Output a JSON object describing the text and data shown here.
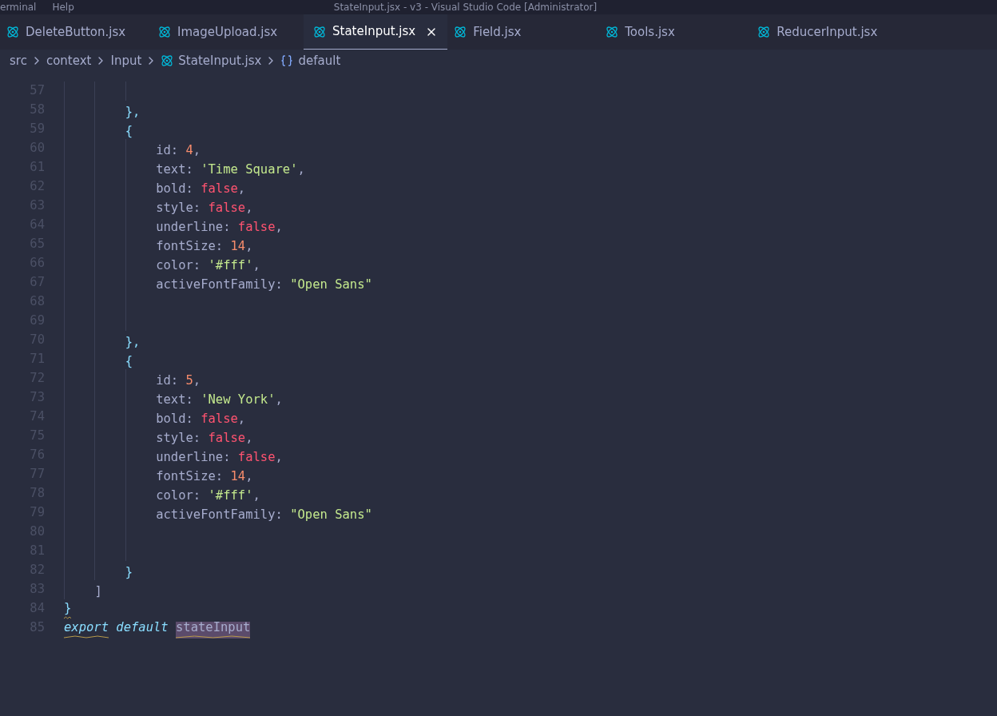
{
  "title_bar": {
    "menu": [
      "erminal",
      "Help"
    ],
    "title": "StateInput.jsx - v3 - Visual Studio Code [Administrator]"
  },
  "tabs": [
    {
      "label": "DeleteButton.jsx",
      "selected": false
    },
    {
      "label": "ImageUpload.jsx",
      "selected": false
    },
    {
      "label": "StateInput.jsx",
      "selected": true
    },
    {
      "label": "Field.jsx",
      "selected": false
    },
    {
      "label": "Tools.jsx",
      "selected": false
    },
    {
      "label": "ReducerInput.jsx",
      "selected": false
    }
  ],
  "breadcrumb": [
    {
      "label": "src",
      "kind": "folder"
    },
    {
      "label": "context",
      "kind": "folder"
    },
    {
      "label": "Input",
      "kind": "folder"
    },
    {
      "label": "StateInput.jsx",
      "kind": "file"
    },
    {
      "label": "default",
      "kind": "symbol"
    }
  ],
  "code": [
    {
      "number": "57",
      "kind": "property"
    },
    {
      "number": "58",
      "kind": "object",
      "tokens": [
        {
          "text": "},",
          "kind": "punct"
        }
      ]
    },
    {
      "number": "59",
      "kind": "object",
      "tokens": [
        {
          "text": "{",
          "kind": "punct"
        }
      ]
    },
    {
      "number": "60",
      "kind": "property",
      "tokens": [
        {
          "text": "id: ",
          "kind": "key"
        },
        {
          "text": "4",
          "kind": "number"
        },
        {
          "text": ",",
          "kind": "key"
        }
      ]
    },
    {
      "number": "61",
      "kind": "property",
      "tokens": [
        {
          "text": "text: ",
          "kind": "key"
        },
        {
          "text": "'Time Square'",
          "kind": "string"
        },
        {
          "text": ",",
          "kind": "key"
        }
      ]
    },
    {
      "number": "62",
      "kind": "property",
      "tokens": [
        {
          "text": "bold: ",
          "kind": "key"
        },
        {
          "text": "false",
          "kind": "boolean"
        },
        {
          "text": ",",
          "kind": "key"
        }
      ]
    },
    {
      "number": "63",
      "kind": "property",
      "tokens": [
        {
          "text": "style: ",
          "kind": "key"
        },
        {
          "text": "false",
          "kind": "boolean"
        },
        {
          "text": ",",
          "kind": "key"
        }
      ]
    },
    {
      "number": "64",
      "kind": "property",
      "tokens": [
        {
          "text": "underline: ",
          "kind": "key"
        },
        {
          "text": "false",
          "kind": "boolean"
        },
        {
          "text": ",",
          "kind": "key"
        }
      ]
    },
    {
      "number": "65",
      "kind": "property",
      "tokens": [
        {
          "text": "fontSize: ",
          "kind": "key"
        },
        {
          "text": "14",
          "kind": "number"
        },
        {
          "text": ",",
          "kind": "key"
        }
      ]
    },
    {
      "number": "66",
      "kind": "property",
      "tokens": [
        {
          "text": "color: ",
          "kind": "key"
        },
        {
          "text": "'#fff'",
          "kind": "string"
        },
        {
          "text": ",",
          "kind": "key"
        }
      ]
    },
    {
      "number": "67",
      "kind": "property",
      "tokens": [
        {
          "text": "activeFontFamily: ",
          "kind": "key"
        },
        {
          "text": "\"Open Sans\"",
          "kind": "string"
        }
      ]
    },
    {
      "number": "68",
      "kind": "property"
    },
    {
      "number": "69",
      "kind": "property"
    },
    {
      "number": "70",
      "kind": "object",
      "tokens": [
        {
          "text": "},",
          "kind": "punct"
        }
      ]
    },
    {
      "number": "71",
      "kind": "object",
      "tokens": [
        {
          "text": "{",
          "kind": "punct"
        }
      ]
    },
    {
      "number": "72",
      "kind": "property",
      "tokens": [
        {
          "text": "id: ",
          "kind": "key"
        },
        {
          "text": "5",
          "kind": "number"
        },
        {
          "text": ",",
          "kind": "key"
        }
      ]
    },
    {
      "number": "73",
      "kind": "property",
      "tokens": [
        {
          "text": "text: ",
          "kind": "key"
        },
        {
          "text": "'New York'",
          "kind": "string"
        },
        {
          "text": ",",
          "kind": "key"
        }
      ]
    },
    {
      "number": "74",
      "kind": "property",
      "tokens": [
        {
          "text": "bold: ",
          "kind": "key"
        },
        {
          "text": "false",
          "kind": "boolean"
        },
        {
          "text": ",",
          "kind": "key"
        }
      ]
    },
    {
      "number": "75",
      "kind": "property",
      "tokens": [
        {
          "text": "style: ",
          "kind": "key"
        },
        {
          "text": "false",
          "kind": "boolean"
        },
        {
          "text": ",",
          "kind": "key"
        }
      ]
    },
    {
      "number": "76",
      "kind": "property",
      "tokens": [
        {
          "text": "underline: ",
          "kind": "key"
        },
        {
          "text": "false",
          "kind": "boolean"
        },
        {
          "text": ",",
          "kind": "key"
        }
      ]
    },
    {
      "number": "77",
      "kind": "property",
      "tokens": [
        {
          "text": "fontSize: ",
          "kind": "key"
        },
        {
          "text": "14",
          "kind": "number"
        },
        {
          "text": ",",
          "kind": "key"
        }
      ]
    },
    {
      "number": "78",
      "kind": "property",
      "tokens": [
        {
          "text": "color: ",
          "kind": "key"
        },
        {
          "text": "'#fff'",
          "kind": "string"
        },
        {
          "text": ",",
          "kind": "key"
        }
      ]
    },
    {
      "number": "79",
      "kind": "property",
      "tokens": [
        {
          "text": "activeFontFamily: ",
          "kind": "key"
        },
        {
          "text": "\"Open Sans\"",
          "kind": "string"
        }
      ]
    },
    {
      "number": "80",
      "kind": "property"
    },
    {
      "number": "81",
      "kind": "property"
    },
    {
      "number": "82",
      "kind": "object",
      "tokens": [
        {
          "text": "}",
          "kind": "punct"
        }
      ]
    },
    {
      "number": "83",
      "kind": "array",
      "tokens": [
        {
          "text": "]",
          "kind": "bracket"
        }
      ]
    },
    {
      "number": "84",
      "kind": "top",
      "tokens": [
        {
          "text": "}",
          "kind": "punct",
          "squiggle": true
        }
      ]
    },
    {
      "number": "85",
      "kind": "top",
      "tokens": [
        {
          "text": "export",
          "kind": "keyword",
          "squiggle": true
        },
        {
          "text": " default ",
          "kind": "keyword"
        },
        {
          "text": "stateInput",
          "kind": "key",
          "highlighted": true,
          "squiggle": true
        }
      ]
    }
  ]
}
